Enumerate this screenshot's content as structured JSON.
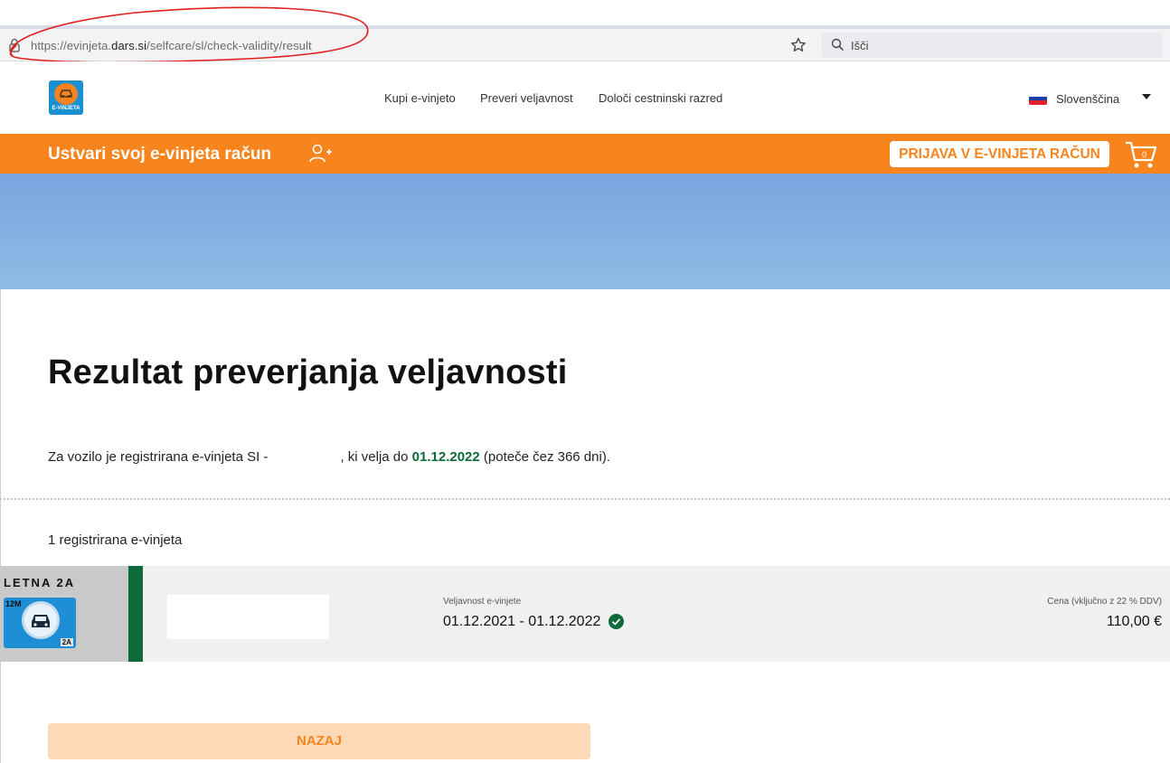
{
  "browser": {
    "url_prefix": "https://evinjeta.",
    "url_domain": "dars.si",
    "url_path": "/selfcare/sl/check-validity/result",
    "search_placeholder": "Išči"
  },
  "header": {
    "logo_label": "E-VINJETA",
    "nav": [
      "Kupi e-vinjeto",
      "Preveri veljavnost",
      "Določi cestninski razred"
    ],
    "language": "Slovenščina"
  },
  "banner": {
    "create_account": "Ustvari svoj e-vinjeta račun",
    "login_button": "PRIJAVA V E-VINJETA RAČUN",
    "cart_count": "0"
  },
  "result": {
    "title": "Rezultat preverjanja veljavnosti",
    "info_before": "Za vozilo je registrirana e-vinjeta SI -",
    "info_middle": ", ki velja do",
    "info_date": "01.12.2022",
    "info_after": "(poteče čez 366 dni).",
    "count_text": "1 registrirana e-vinjeta"
  },
  "vignette": {
    "type": "LETNA 2A",
    "badge_period": "12M",
    "badge_class": "2A",
    "validity_label": "Veljavnost e-vinjete",
    "validity_dates": "01.12.2021 - 01.12.2022",
    "price_label": "Cena (vključno z 22 % DDV)",
    "price": "110,00 €"
  },
  "actions": {
    "back": "NAZAJ"
  },
  "colors": {
    "brand_orange": "#f7841c",
    "valid_green": "#0e6b39",
    "logo_blue": "#1a90d0"
  }
}
